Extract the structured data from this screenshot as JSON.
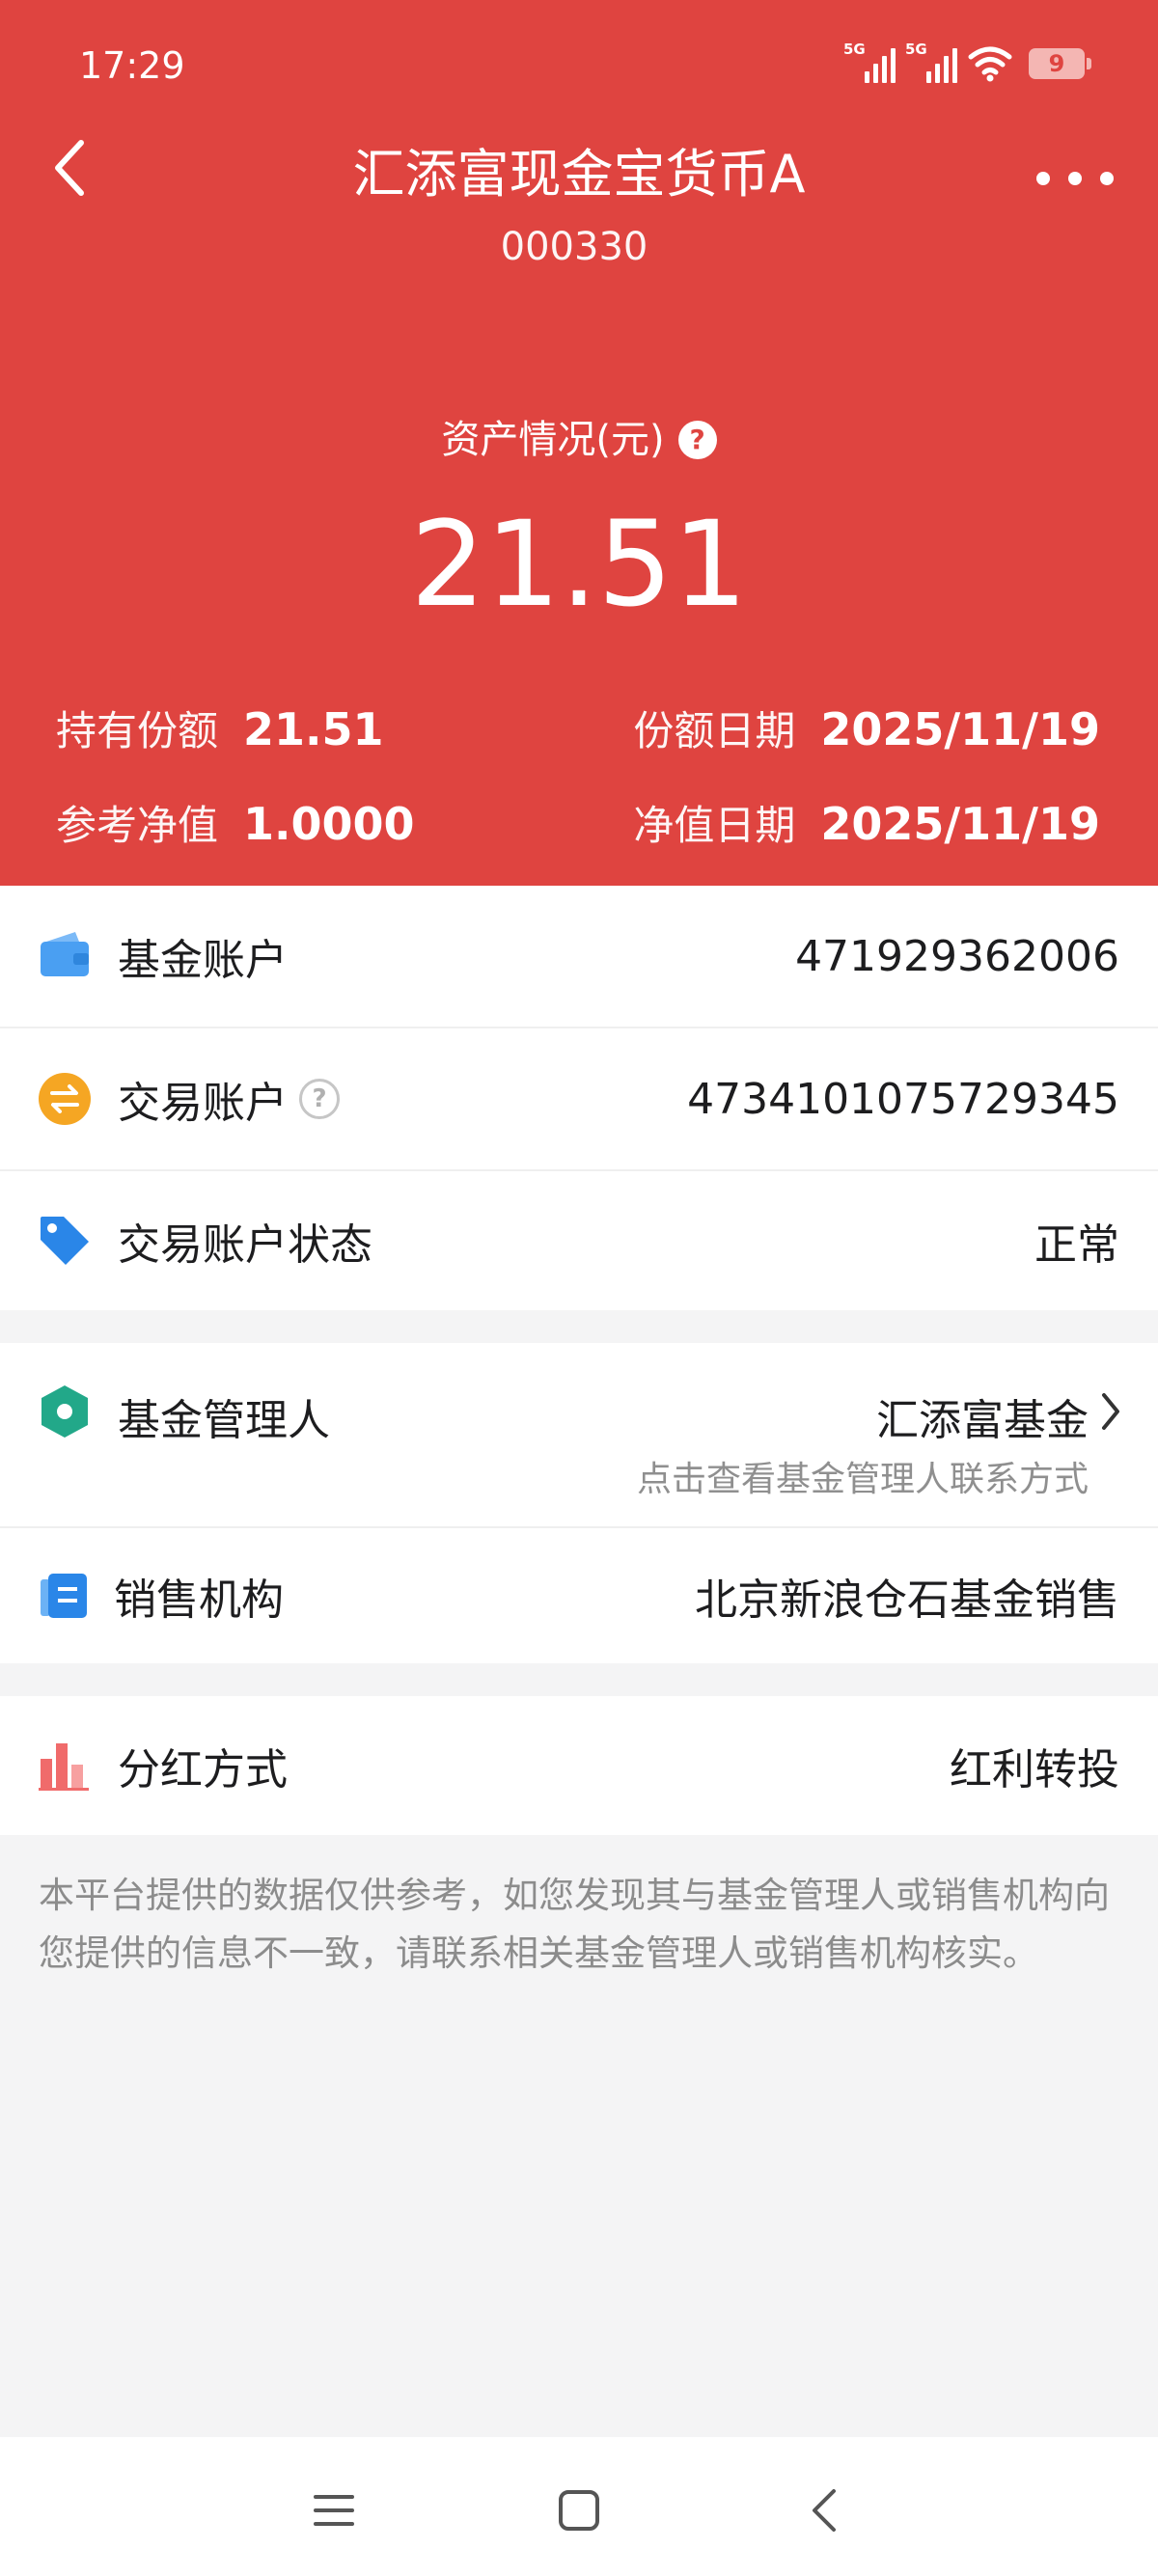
{
  "status_bar": {
    "time": "17:29",
    "signal1_label": "5G",
    "signal2_label": "5G",
    "battery": "9"
  },
  "header": {
    "fund_name": "汇添富现金宝货币A",
    "fund_code": "000330",
    "asset_label": "资产情况(元)",
    "asset_value": "21.51",
    "holding_label": "持有份额",
    "holding_value": "21.51",
    "share_date_label": "份额日期",
    "share_date_value": "2025/11/19",
    "nav_label": "参考净值",
    "nav_value": "1.0000",
    "nav_date_label": "净值日期",
    "nav_date_value": "2025/11/19"
  },
  "accounts": {
    "fund_account_label": "基金账户",
    "fund_account_value": "471929362006",
    "trade_account_label": "交易账户",
    "trade_account_value": "4734101075729345",
    "trade_status_label": "交易账户状态",
    "trade_status_value": "正常"
  },
  "management": {
    "manager_label": "基金管理人",
    "manager_value": "汇添富基金",
    "manager_hint": "点击查看基金管理人联系方式",
    "sales_label": "销售机构",
    "sales_value": "北京新浪仓石基金销售"
  },
  "dividend": {
    "label": "分红方式",
    "value": "红利转投"
  },
  "disclaimer": "本平台提供的数据仅供参考，如您发现其与基金管理人或销售机构向您提供的信息不一致，请联系相关基金管理人或销售机构核实。",
  "colors": {
    "header_bg": "#df4440",
    "wallet_icon": "#4a9ff2",
    "exchange_icon": "#f5a623",
    "tag_icon": "#2a86e8",
    "manager_icon": "#22a889",
    "sales_icon": "#2a86e8",
    "dividend_icon": "#f06b6b"
  },
  "icons": {
    "back": "chevron-left-icon",
    "more": "more-dots-icon",
    "fund_account": "wallet-icon",
    "trade_account": "exchange-icon",
    "trade_status": "tag-icon",
    "manager": "hexagon-icon",
    "sales": "document-icon",
    "dividend": "bar-chart-icon"
  }
}
